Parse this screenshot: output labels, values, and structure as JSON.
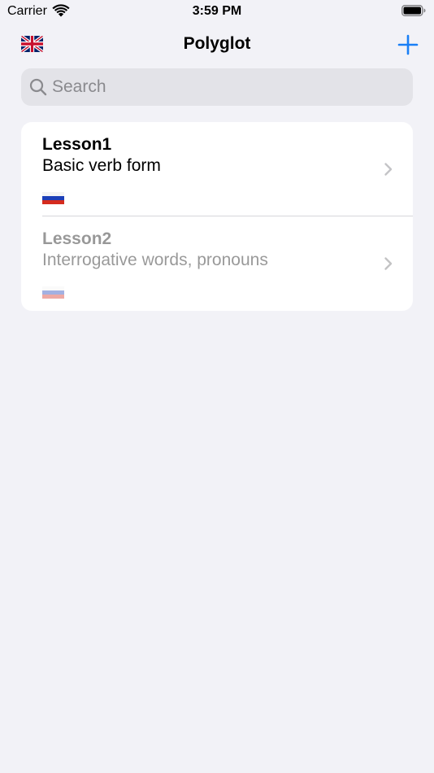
{
  "status_bar": {
    "carrier": "Carrier",
    "time": "3:59 PM",
    "wifi_icon": "wifi-icon",
    "battery_icon": "battery-icon"
  },
  "nav": {
    "title": "Polyglot",
    "left_icon": "flag-uk-icon",
    "right_icon": "plus-icon",
    "accent_color": "#1a7ff6"
  },
  "search": {
    "placeholder": "Search",
    "value": ""
  },
  "lessons": [
    {
      "title": "Lesson1",
      "subtitle": "Basic verb form",
      "flag_icon": "flag-ru-icon",
      "dimmed": false
    },
    {
      "title": "Lesson2",
      "subtitle": "Interrogative words, pronouns",
      "flag_icon": "flag-ru-icon",
      "dimmed": true
    }
  ],
  "colors": {
    "background": "#f2f2f7",
    "card": "#ffffff",
    "search_field": "#e3e3e8",
    "secondary_text": "#8a8a8e",
    "chevron": "#c4c4c7"
  }
}
